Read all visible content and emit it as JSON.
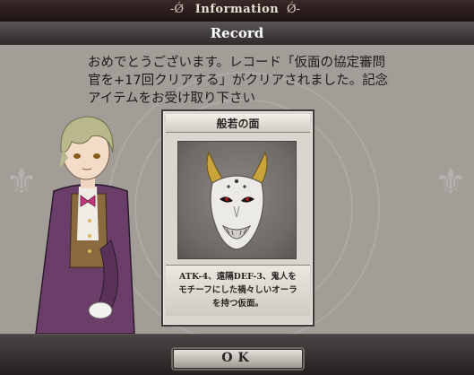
{
  "header": {
    "title": "Information",
    "ornament_left": "-Ǿ",
    "ornament_right": "Ǿ-"
  },
  "dialog": {
    "title": "Record",
    "message_lines": [
      "おめでとうございます。レコード「仮面の協定審問",
      "官を+17回クリアする」がクリアされました。記念",
      "アイテムをお受け取り下さい"
    ]
  },
  "item": {
    "name": "般若の面",
    "description_lines": [
      "ATK-4、遠隔DEF-3、鬼人を",
      "モチーフにした禍々しいオーラ",
      "を持つ仮面。"
    ],
    "icon": "hannya-mask-icon"
  },
  "footer": {
    "ok_label": "OK"
  },
  "colors": {
    "panel": "#a39d97",
    "mask_horns": "#c9a43a",
    "mask_eyes": "#a01818"
  }
}
